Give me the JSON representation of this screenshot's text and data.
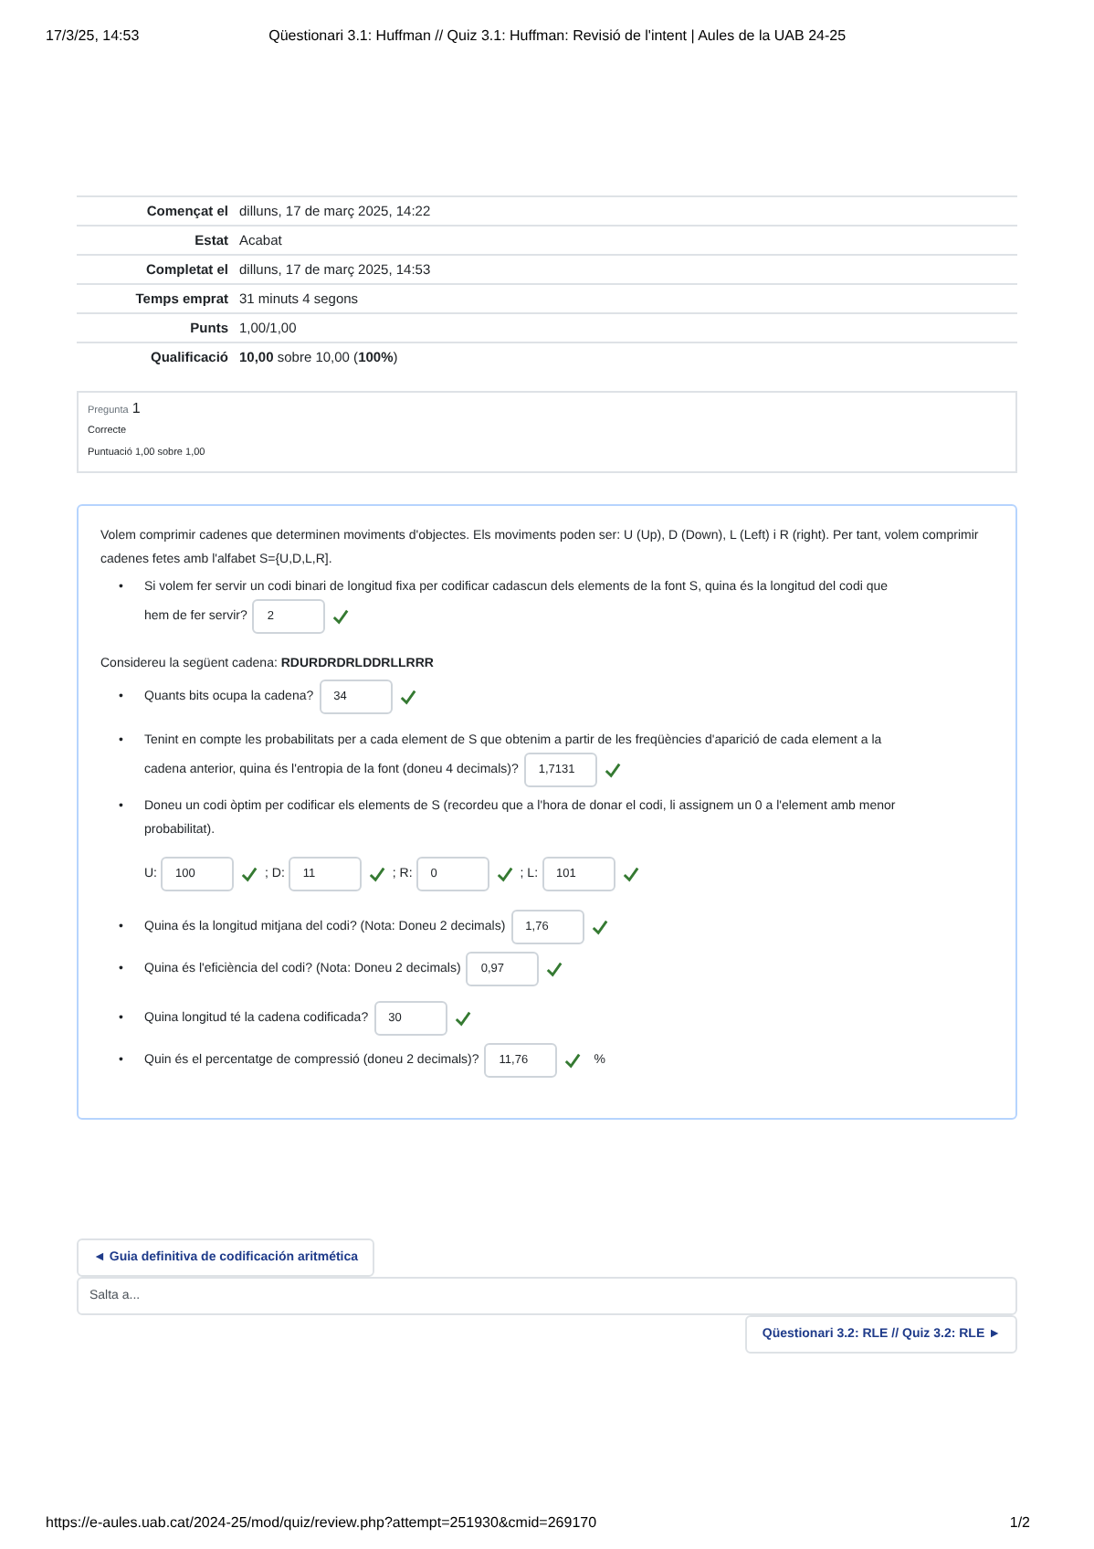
{
  "print_header": {
    "date": "17/3/25, 14:53",
    "title": "Qüestionari 3.1: Huffman // Quiz 3.1: Huffman: Revisió de l'intent | Aules de la UAB 24-25"
  },
  "summary": [
    {
      "label": "Començat el",
      "value": "dilluns, 17 de març 2025, 14:22"
    },
    {
      "label": "Estat",
      "value": "Acabat"
    },
    {
      "label": "Completat el",
      "value": "dilluns, 17 de març 2025, 14:53"
    },
    {
      "label": "Temps emprat",
      "value": "31 minuts 4 segons"
    },
    {
      "label": "Punts",
      "value": "1,00/1,00"
    },
    {
      "label": "Qualificació",
      "value": "**10,00** sobre 10,00 (**100%**)"
    }
  ],
  "question_info": {
    "label": "Pregunta",
    "number": "1",
    "status": "Correcte",
    "score": "Puntuació 1,00 sobre 1,00"
  },
  "question": [
    {
      "kind": "paragraph",
      "text": "Volem comprimir cadenes que determinen moviments d'objectes. Els moviments poden ser: U (Up), D (Down), L (Left) i R (right). Per tant, volem comprimir cadenes fetes amb l'alfabet S={U,D,L,R]."
    },
    {
      "kind": "bullet",
      "marker": "•",
      "lines": [
        "Si volem fer servir un codi binari de longitud fixa per codificar cadascun dels elements de la font S, quina és la longitud del codi que",
        "hem de fer servir?"
      ],
      "answer": {
        "value": "2",
        "correct": true
      }
    },
    {
      "kind": "paragraph",
      "text": "Considereu la següent cadena: **RDURDRDRLDDRLLRRR**"
    },
    {
      "kind": "bullet",
      "marker": "•",
      "lines": [
        "Quants bits ocupa la cadena?"
      ],
      "answer": {
        "value": "34",
        "correct": true
      }
    },
    {
      "kind": "bullet",
      "marker": "•",
      "lines": [
        "Tenint en compte les probabilitats per a cada element de S que obtenim a partir de les freqüències d'aparició de cada element a la",
        "cadena anterior, quina és l'entropia de la font (doneu 4 decimals)?"
      ],
      "answer": {
        "value": "1,7131",
        "correct": true
      }
    },
    {
      "kind": "bullet",
      "marker": "•",
      "lines": [
        "Doneu un codi òptim per codificar els elements de S (recordeu que a l'hora de donar el codi, li assignem un 0 a l'element amb menor",
        "probabilitat)."
      ]
    },
    {
      "kind": "codes",
      "fields": [
        {
          "label": "U:",
          "value": "100",
          "correct": true
        },
        {
          "label": "; D:",
          "value": "11",
          "correct": true
        },
        {
          "label": "; R:",
          "value": "0",
          "correct": true
        },
        {
          "label": "; L:",
          "value": "101",
          "correct": true
        }
      ]
    },
    {
      "kind": "bullet",
      "marker": "•",
      "lines": [
        "Quina és la longitud mitjana del codi? (Nota: Doneu 2 decimals)"
      ],
      "answer": {
        "value": "1,76",
        "correct": true
      }
    },
    {
      "kind": "bullet",
      "marker": "•",
      "lines": [
        "Quina és l'eficiència del codi? (Nota: Doneu 2 decimals)"
      ],
      "answer": {
        "value": "0,97",
        "correct": true
      }
    },
    {
      "kind": "bullet",
      "marker": "•",
      "lines": [
        "Quina longitud té la cadena codificada?"
      ],
      "answer": {
        "value": "30",
        "correct": true
      }
    },
    {
      "kind": "bullet",
      "marker": "•",
      "lines": [
        "Quin és el percentatge de compressió (doneu 2 decimals)?"
      ],
      "answer": {
        "value": "11,76",
        "correct": true
      },
      "suffix": "%"
    }
  ],
  "navigation": {
    "previous": "◄ Guia definitiva de codificación aritmética",
    "jump_placeholder": "Salta a...",
    "next": "Qüestionari 3.2: RLE // Quiz 3.2: RLE ►"
  },
  "print_footer": {
    "url": "https://e-aules.uab.cat/2024-25/mod/quiz/review.php?attempt=251930&cmid=269170",
    "page": "1/2"
  }
}
